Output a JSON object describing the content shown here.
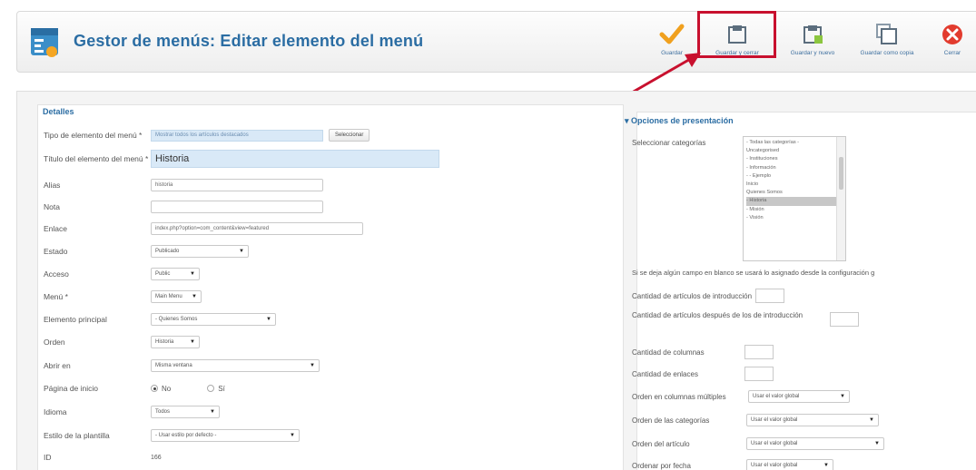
{
  "header": {
    "title": "Gestor de menús: Editar elemento del menú"
  },
  "toolbar": {
    "save": "Guardar",
    "save_close": "Guardar y cerrar",
    "save_new": "Guardar y nuevo",
    "save_copy": "Guardar como copia",
    "close": "Cerrar"
  },
  "details": {
    "legend": "Detalles",
    "type_label": "Tipo de elemento del menú *",
    "type_value": "Mostrar todos los artículos destacados",
    "select_button": "Seleccionar",
    "title_label": "Título del elemento del menú *",
    "title_value": "Historia",
    "alias_label": "Alias",
    "alias_value": "historia",
    "note_label": "Nota",
    "note_value": "",
    "link_label": "Enlace",
    "link_value": "index.php?option=com_content&view=featured",
    "status_label": "Estado",
    "status_value": "Publicado",
    "access_label": "Acceso",
    "access_value": "Public",
    "menu_label": "Menú *",
    "menu_value": "Main Menu",
    "parent_label": "Elemento principal",
    "parent_value": "- Quienes Somos",
    "order_label": "Orden",
    "order_value": "Historia",
    "open_label": "Abrir en",
    "open_value": "Misma ventana",
    "home_label": "Página de inicio",
    "home_no": "No",
    "home_yes": "Sí",
    "lang_label": "Idioma",
    "lang_value": "Todos",
    "style_label": "Estilo de la plantilla",
    "style_value": "- Usar estilo por defecto -",
    "id_label": "ID",
    "id_value": "166"
  },
  "options": {
    "title": "Opciones de presentación",
    "categories_label": "Seleccionar categorías",
    "categories": [
      "- Todas las categorías -",
      "Uncategorised",
      "- Instituciones",
      "- Información",
      "- - Ejemplo",
      "Inicio",
      "Quienes Somos",
      "- Historia",
      "- Misión",
      "- Visión"
    ],
    "categories_active": 7,
    "note": "Si se deja algún campo en blanco se usará lo asignado desde la configuración g",
    "intro_label": "Cantidad de artículos de introducción",
    "after_intro_label": "Cantidad de artículos después de los de introducción",
    "columns_label": "Cantidad de columnas",
    "links_label": "Cantidad de enlaces",
    "multicol_label": "Orden en columnas múltiples",
    "multicol_value": "Usar el valor global",
    "cat_order_label": "Orden de las categorías",
    "cat_order_value": "Usar el valor global",
    "art_order_label": "Orden del artículo",
    "art_order_value": "Usar el valor global",
    "date_order_label": "Ordenar por fecha",
    "date_order_value": "Usar el valor global"
  },
  "colors": {
    "accent": "#2b6da3",
    "highlight": "#c8102e"
  },
  "icons": {
    "logo": "menu-manager-icon",
    "save": "check-icon",
    "save_close": "save-close-icon",
    "save_new": "save-new-icon",
    "save_copy": "save-copy-icon",
    "close": "close-icon"
  }
}
